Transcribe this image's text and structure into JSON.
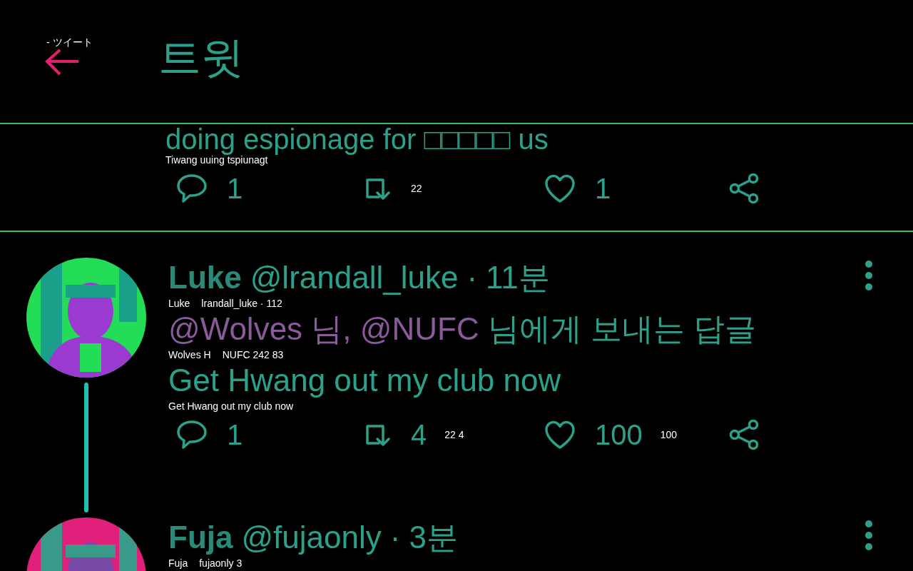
{
  "header": {
    "title": "트윗",
    "back_overlay": "- ツイート"
  },
  "tweets": [
    {
      "kind": "partial",
      "text": "doing espionage for □□□□□ us",
      "text_overlay": "Tiwang uuing tspiunagt",
      "actions": [
        {
          "kind": "reply",
          "count": "1"
        },
        {
          "kind": "retweet",
          "overlay": "22"
        },
        {
          "kind": "like",
          "count": "1"
        },
        {
          "kind": "share"
        }
      ]
    },
    {
      "kind": "full",
      "name": "Luke",
      "handle": "@lrandall_luke",
      "separator": "·",
      "time": "11분",
      "name_overlays": [
        "Luke",
        "lrandall_luke · 112"
      ],
      "reply_to": [
        {
          "kind": "mention",
          "text": "@Wolves 님, @NUFC"
        },
        {
          "kind": "plain",
          "text": " 님에게 보내는 답글"
        }
      ],
      "reply_overlays": [
        "Wolves H",
        "NUFC 242 83"
      ],
      "text": "Get Hwang out my club now",
      "text_overlay": "Get Hwang out my club now",
      "actions": [
        {
          "kind": "reply",
          "count": "1"
        },
        {
          "kind": "retweet",
          "count": "4",
          "overlay": "22 4"
        },
        {
          "kind": "like",
          "count": "100",
          "overlay": "100"
        },
        {
          "kind": "share"
        }
      ],
      "thread_line": true
    },
    {
      "kind": "full",
      "name": "Fuja",
      "handle": "@fujaonly",
      "separator": "·",
      "time": "3분",
      "name_overlays": [
        "Fuja",
        "fujaonly 3"
      ],
      "thread_line": false
    }
  ]
}
